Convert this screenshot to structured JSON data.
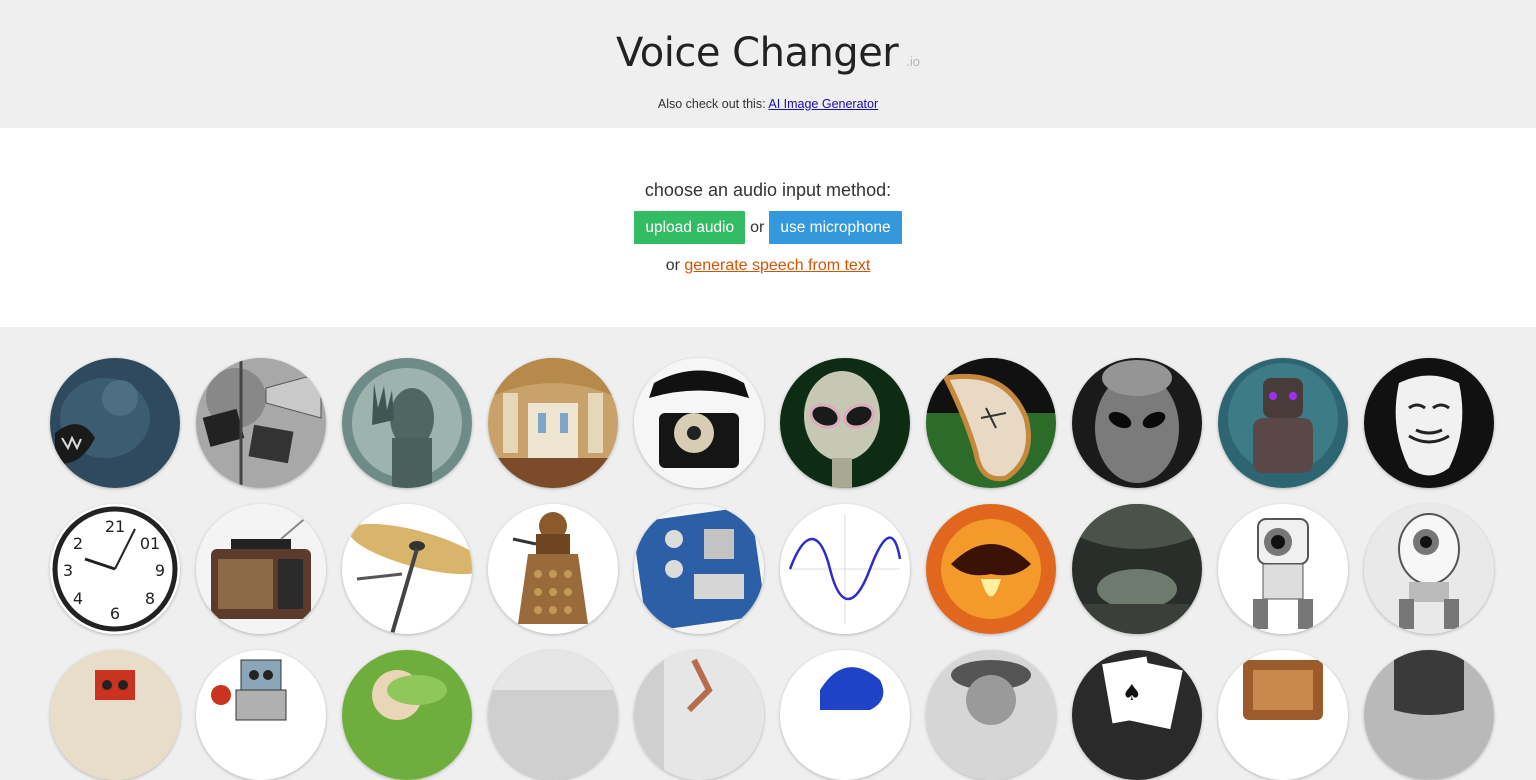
{
  "header": {
    "title": "Voice Changer",
    "tld": ".io",
    "checkout_prefix": "Also check out this:",
    "checkout_link": "AI Image Generator"
  },
  "input": {
    "prompt": "choose an audio input method:",
    "upload_label": "upload audio",
    "or_label": "or",
    "mic_label": "use microphone",
    "tts_prefix": "or",
    "tts_link": "generate speech from text"
  },
  "colors": {
    "upload_button": "#33bc64",
    "mic_button": "#3398dc",
    "tts_link": "#d35400",
    "link": "#1a0dab"
  },
  "voices": [
    {
      "icon": "monster-icon"
    },
    {
      "icon": "megaphone-icon"
    },
    {
      "icon": "ghost-icon"
    },
    {
      "icon": "cathedral-icon"
    },
    {
      "icon": "telephone-icon"
    },
    {
      "icon": "alien-icon"
    },
    {
      "icon": "melting-clock-icon"
    },
    {
      "icon": "grey-alien-icon"
    },
    {
      "icon": "robot-armor-icon"
    },
    {
      "icon": "anonymous-mask-icon"
    },
    {
      "icon": "reversed-clock-icon"
    },
    {
      "icon": "radio-icon"
    },
    {
      "icon": "cymbal-icon"
    },
    {
      "icon": "dalek-icon"
    },
    {
      "icon": "synth-pedal-icon"
    },
    {
      "icon": "sine-wave-icon"
    },
    {
      "icon": "fire-demon-icon"
    },
    {
      "icon": "cave-icon"
    },
    {
      "icon": "cat-robot-icon"
    },
    {
      "icon": "eye-robot-icon"
    },
    {
      "icon": "toy-robot-icon"
    },
    {
      "icon": "tin-robot-icon"
    },
    {
      "icon": "snail-icon"
    },
    {
      "icon": "foggy-icon"
    },
    {
      "icon": "dancer-icon"
    },
    {
      "icon": "sonic-icon"
    },
    {
      "icon": "old-man-icon"
    },
    {
      "icon": "playing-cards-icon"
    },
    {
      "icon": "radio-cabinet-icon"
    },
    {
      "icon": "dark-portrait-icon"
    }
  ]
}
